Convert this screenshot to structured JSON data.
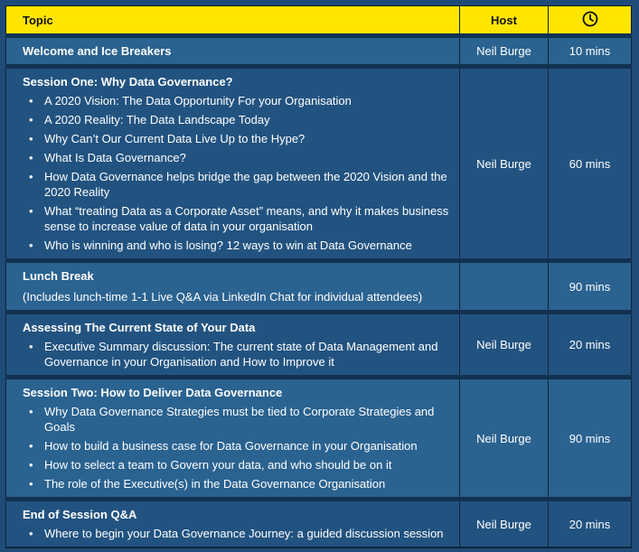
{
  "header": {
    "topic": "Topic",
    "host": "Host",
    "time_icon": "clock-icon"
  },
  "rows": [
    {
      "title": "Welcome and Ice Breakers",
      "host": "Neil Burge",
      "duration": "10 mins"
    },
    {
      "title": "Session One: Why Data Governance?",
      "items": [
        "A 2020 Vision: The Data Opportunity For your Organisation",
        "A 2020 Reality: The Data Landscape Today",
        "Why Can’t Our Current Data Live Up to the Hype?",
        "What Is Data Governance?",
        "How Data Governance helps bridge the gap between the 2020 Vision and the 2020 Reality",
        "What “treating Data as a Corporate Asset” means, and why it makes business sense to increase value of data in your organisation",
        "Who is winning and who is losing? 12 ways to win at Data Governance"
      ],
      "host": "Neil Burge",
      "duration": "60 mins"
    },
    {
      "title": "Lunch Break",
      "note": "(Includes lunch-time 1-1 Live Q&A via LinkedIn Chat for individual attendees)",
      "host": "",
      "duration": "90 mins"
    },
    {
      "title": "Assessing The Current State of Your Data",
      "items": [
        "Executive Summary discussion: The current state of Data Management and Governance in your Organisation and How to Improve it"
      ],
      "host": "Neil Burge",
      "duration": "20 mins"
    },
    {
      "title": "Session Two: How to Deliver Data Governance",
      "items": [
        "Why Data Governance Strategies must be tied to Corporate Strategies and Goals",
        "How to build a business case for Data Governance in your Organisation",
        "How to select a team to Govern your data, and who should be on it",
        "The role of the Executive(s) in the Data Governance Organisation"
      ],
      "host": "Neil Burge",
      "duration": "90 mins"
    },
    {
      "title": "End of Session Q&A",
      "items": [
        "Where to begin your Data Governance Journey: a guided discussion session"
      ],
      "host": "Neil Burge",
      "duration": "20 mins"
    }
  ]
}
